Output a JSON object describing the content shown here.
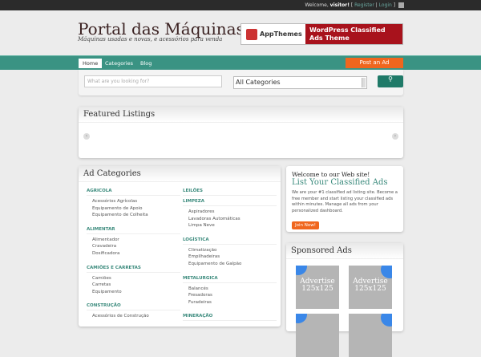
{
  "topbar": {
    "welcome": "Welcome,",
    "user": "visitor!",
    "register": "Register",
    "login": "Login"
  },
  "header": {
    "title": "Portal das Máquinas",
    "tagline": "Máquinas usadas e novas, e acessórios para venda",
    "banner_brand": "AppThemes",
    "banner_text": "WordPress Classified Ads Theme"
  },
  "nav": {
    "items": [
      "Home",
      "Categories",
      "Blog"
    ],
    "post_ad": "Post an Ad"
  },
  "search": {
    "placeholder": "What are you looking for?",
    "category": "All Categories"
  },
  "featured": {
    "title": "Featured Listings"
  },
  "categories": {
    "title": "Ad Categories",
    "left": [
      {
        "name": "AGRICOLA",
        "subs": [
          "Acessórios Agrícolas",
          "Equipamento de Apoio",
          "Equipamento de Colheita"
        ]
      },
      {
        "name": "ALIMENTAR",
        "subs": [
          "Alimentador",
          "Cravadeira",
          "Dosificadora"
        ]
      },
      {
        "name": "CAMIÕES E CARRETAS",
        "subs": [
          "Camiões",
          "Carretas",
          "Equipamento"
        ]
      },
      {
        "name": "CONSTRUÇÃO",
        "subs": [
          "Acessórios de Construção"
        ]
      }
    ],
    "right": [
      {
        "name": "LEILÕES",
        "subs": []
      },
      {
        "name": "LIMPEZA",
        "subs": [
          "Aspiradores",
          "Lavadoras Automáticas",
          "Limpa Neve"
        ]
      },
      {
        "name": "LOGÍSTICA",
        "subs": [
          "Climatização",
          "Empilhadeiras",
          "Equipamento de Galpão"
        ]
      },
      {
        "name": "METALURGICA",
        "subs": [
          "Balancés",
          "Fresadoras",
          "Furadeiras"
        ]
      },
      {
        "name": "MINERAÇÃO",
        "subs": []
      }
    ]
  },
  "welcome": {
    "heading": "Welcome to our Web site!",
    "title": "List Your Classified Ads",
    "text": "We are your #1 classified ad listing site. Become a free member and start listing your classified ads within minutes. Manage all ads from your personalized dashboard.",
    "join": "Join Now!"
  },
  "sponsored": {
    "title": "Sponsored Ads",
    "ad_text": "Advertise 125x125"
  }
}
